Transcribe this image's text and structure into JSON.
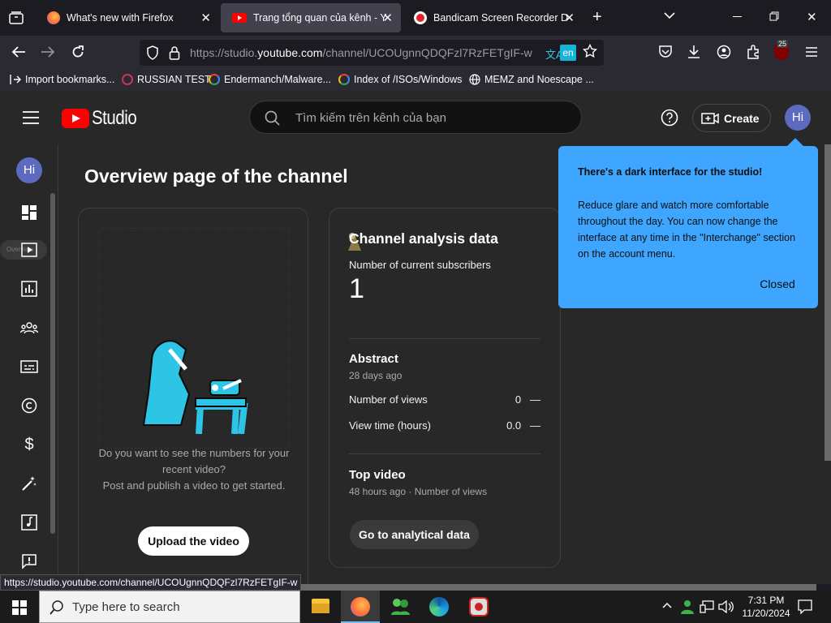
{
  "tabs": [
    {
      "title": "What's new with Firefox"
    },
    {
      "title": "Trang tổng quan của kênh - YouTube Studio"
    },
    {
      "title": "Bandicam Screen Recorder Download"
    }
  ],
  "url": {
    "prefix": "https://studio.",
    "domain": "youtube.com",
    "rest": "/channel/UCOUgnnQDQFzl7RzFETgIF-w"
  },
  "translate_lang": "en",
  "badge_count": "25",
  "bookmarks": [
    "Import bookmarks...",
    "RUSSIAN TEST",
    "Endermanch/Malware...",
    "Index of /ISOs/Windows",
    "MEMZ and Noescape ..."
  ],
  "studio": {
    "logo": "Studio",
    "search_placeholder": "Tìm kiếm trên kênh của bạn",
    "create": "Create",
    "avatar": "Hi",
    "side_tooltip": "Overview"
  },
  "page_title": "Overview page of the channel",
  "upload_card": {
    "text1": "Do you want to see the numbers for your recent video?",
    "text2": "Post and publish a video to get started.",
    "button": "Upload the video"
  },
  "analytics": {
    "title": "Channel analysis data",
    "subs_label": "Number of current subscribers",
    "subs_value": "1",
    "summary_title": "Abstract",
    "summary_sub": "28 days ago",
    "rows": [
      {
        "label": "Number of views",
        "value": "0",
        "trend": "—"
      },
      {
        "label": "View time (hours)",
        "value": "0.0",
        "trend": "—"
      }
    ],
    "top_title": "Top video",
    "top_sub": "48 hours ago · Number of views",
    "button": "Go to analytical data"
  },
  "popup": {
    "title": "There's a dark interface for the studio!",
    "body": "Reduce glare and watch more comfortable throughout the day. You can now change the interface at any time in the \"Interchange\" section on the account menu.",
    "button": "Closed"
  },
  "status_url": "https://studio.youtube.com/channel/UCOUgnnQDQFzl7RzFETgIF-w",
  "taskbar": {
    "search": "Type here to search",
    "time": "7:31 PM",
    "date": "11/20/2024"
  },
  "colors": {
    "accent": "#3ea6ff",
    "yt_red": "#ff0000",
    "avatar": "#5c6bc0"
  }
}
